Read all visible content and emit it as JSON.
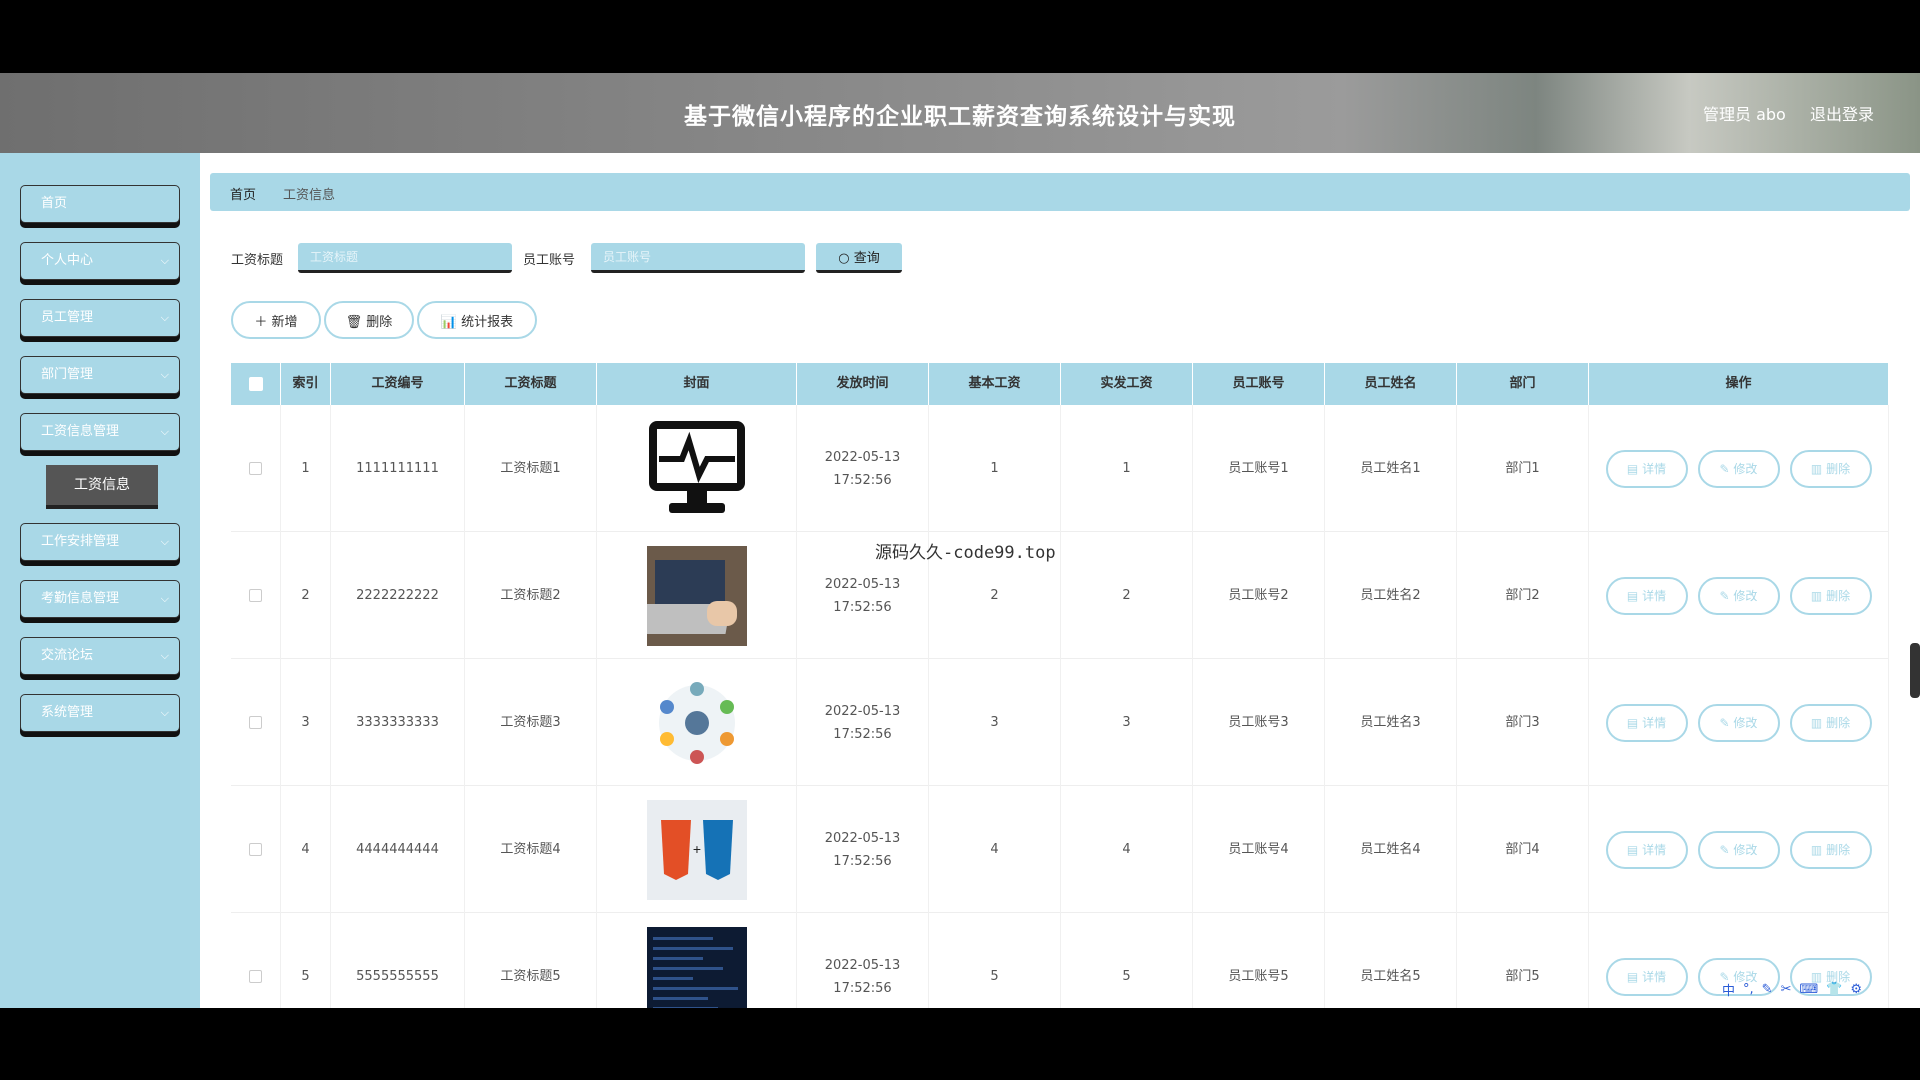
{
  "header": {
    "title": "基于微信小程序的企业职工薪资查询系统设计与实现",
    "user": "管理员 abo",
    "logout": "退出登录"
  },
  "sidebar": {
    "items": [
      {
        "label": "首页",
        "chevron": ""
      },
      {
        "label": "个人中心",
        "chevron": "⌵"
      },
      {
        "label": "员工管理",
        "chevron": "⌵"
      },
      {
        "label": "部门管理",
        "chevron": "⌵"
      },
      {
        "label": "工资信息管理",
        "chevron": "⌵"
      },
      {
        "label": "工作安排管理",
        "chevron": "⌵"
      },
      {
        "label": "考勤信息管理",
        "chevron": "⌵"
      },
      {
        "label": "交流论坛",
        "chevron": "⌵"
      },
      {
        "label": "系统管理",
        "chevron": "⌵"
      }
    ],
    "sub_item": "工资信息"
  },
  "breadcrumb": {
    "home": "首页",
    "current": "工资信息"
  },
  "search": {
    "title_label": "工资标题",
    "title_placeholder": "工资标题",
    "account_label": "员工账号",
    "account_placeholder": "员工账号",
    "button": "查询"
  },
  "actions": {
    "add": "＋ 新增",
    "delete": "🗑 删除",
    "report": "📊 统计报表"
  },
  "table": {
    "headers": [
      "",
      "索引",
      "工资编号",
      "工资标题",
      "封面",
      "发放时间",
      "基本工资",
      "实发工资",
      "员工账号",
      "员工姓名",
      "部门",
      "操作"
    ],
    "op_labels": {
      "detail": "详情",
      "edit": "修改",
      "delete": "删除"
    },
    "rows": [
      {
        "index": "1",
        "no": "1111111111",
        "title": "工资标题1",
        "time": "2022-05-13 17:52:56",
        "base": "1",
        "actual": "1",
        "account": "员工账号1",
        "name": "员工姓名1",
        "dept": "部门1",
        "cover": "monitor-pulse"
      },
      {
        "index": "2",
        "no": "2222222222",
        "title": "工资标题2",
        "time": "2022-05-13 17:52:56",
        "base": "2",
        "actual": "2",
        "account": "员工账号2",
        "name": "员工姓名2",
        "dept": "部门2",
        "cover": "laptop-photo"
      },
      {
        "index": "3",
        "no": "3333333333",
        "title": "工资标题3",
        "time": "2022-05-13 17:52:56",
        "base": "3",
        "actual": "3",
        "account": "员工账号3",
        "name": "员工姓名3",
        "dept": "部门3",
        "cover": "circle-diagram"
      },
      {
        "index": "4",
        "no": "4444444444",
        "title": "工资标题4",
        "time": "2022-05-13 17:52:56",
        "base": "4",
        "actual": "4",
        "account": "员工账号4",
        "name": "员工姓名4",
        "dept": "部门4",
        "cover": "html5-css3"
      },
      {
        "index": "5",
        "no": "5555555555",
        "title": "工资标题5",
        "time": "2022-05-13 17:52:56",
        "base": "5",
        "actual": "5",
        "account": "员工账号5",
        "name": "员工姓名5",
        "dept": "部门5",
        "cover": "code-dark"
      }
    ]
  },
  "watermark": "源码久久-code99.top",
  "ime": {
    "chars": [
      "中",
      "°,",
      "✎",
      "✂",
      "⌨",
      "👕",
      "⚙"
    ]
  },
  "colors": {
    "accent": "#a9d8e7",
    "header_bg": "#8a8a8a"
  }
}
